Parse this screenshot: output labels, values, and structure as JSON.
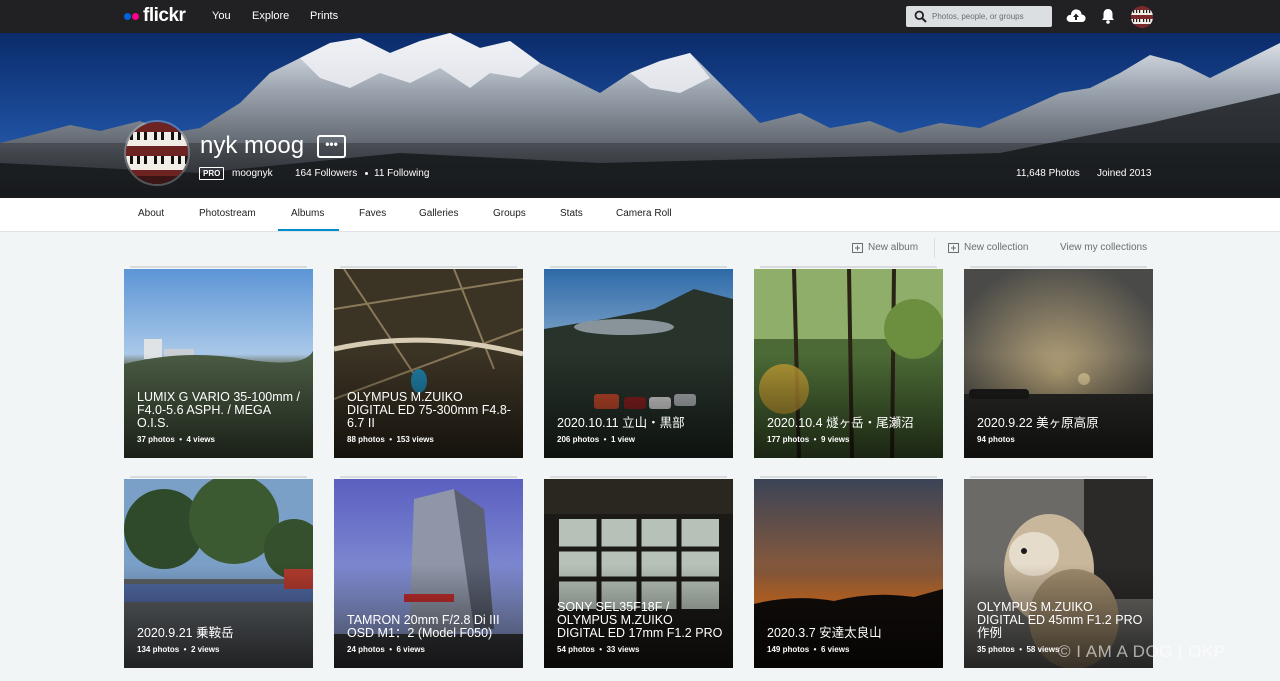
{
  "header": {
    "logo_text": "flickr",
    "nav": [
      "You",
      "Explore",
      "Prints"
    ],
    "search_placeholder": "Photos, people, or groups",
    "icons": [
      "search-icon",
      "upload-icon",
      "bell-icon"
    ]
  },
  "profile": {
    "name": "nyk moog",
    "more_label": "•••",
    "pro_label": "PRO",
    "username": "moognyk",
    "followers": "164 Followers",
    "following": "11 Following",
    "photos": "11,648 Photos",
    "joined": "Joined 2013"
  },
  "subnav": [
    "About",
    "Photostream",
    "Albums",
    "Faves",
    "Galleries",
    "Groups",
    "Stats",
    "Camera Roll"
  ],
  "active_tab": "Albums",
  "actions": {
    "new_album": "New album",
    "new_collection": "New collection",
    "view_collections": "View my collections"
  },
  "albums": [
    {
      "title": "LUMIX G VARIO 35-100mm / F4.0-5.6 ASPH. / MEGA O.I.S.",
      "photos": "37 photos",
      "views": "4 views"
    },
    {
      "title": "OLYMPUS M.ZUIKO DIGITAL ED 75-300mm F4.8-6.7 II",
      "photos": "88 photos",
      "views": "153 views"
    },
    {
      "title": "2020.10.11 立山・黒部",
      "photos": "206 photos",
      "views": "1 view"
    },
    {
      "title": "2020.10.4 燧ヶ岳・尾瀬沼",
      "photos": "177 photos",
      "views": "9 views"
    },
    {
      "title": "2020.9.22 美ヶ原高原",
      "photos": "94 photos",
      "views": ""
    },
    {
      "title": "2020.9.21 乗鞍岳",
      "photos": "134 photos",
      "views": "2 views"
    },
    {
      "title": "TAMRON 20mm F/2.8 Di III OSD M1：2 (Model F050)",
      "photos": "24 photos",
      "views": "6 views"
    },
    {
      "title": "SONY SEL35F18F / OLYMPUS M.ZUIKO DIGITAL ED 17mm F1.2 PRO",
      "photos": "54 photos",
      "views": "33 views"
    },
    {
      "title": "2020.3.7 安達太良山",
      "photos": "149 photos",
      "views": "6 views"
    },
    {
      "title": "OLYMPUS M.ZUIKO DIGITAL ED 45mm F1.2 PRO 作例",
      "photos": "35 photos",
      "views": "58 views"
    }
  ],
  "watermark": "© I AM A DOG | OKP",
  "colors": {
    "topbar": "#212124",
    "accent": "#008ecf",
    "flickr_blue": "#0063dc",
    "flickr_pink": "#ff0084"
  }
}
